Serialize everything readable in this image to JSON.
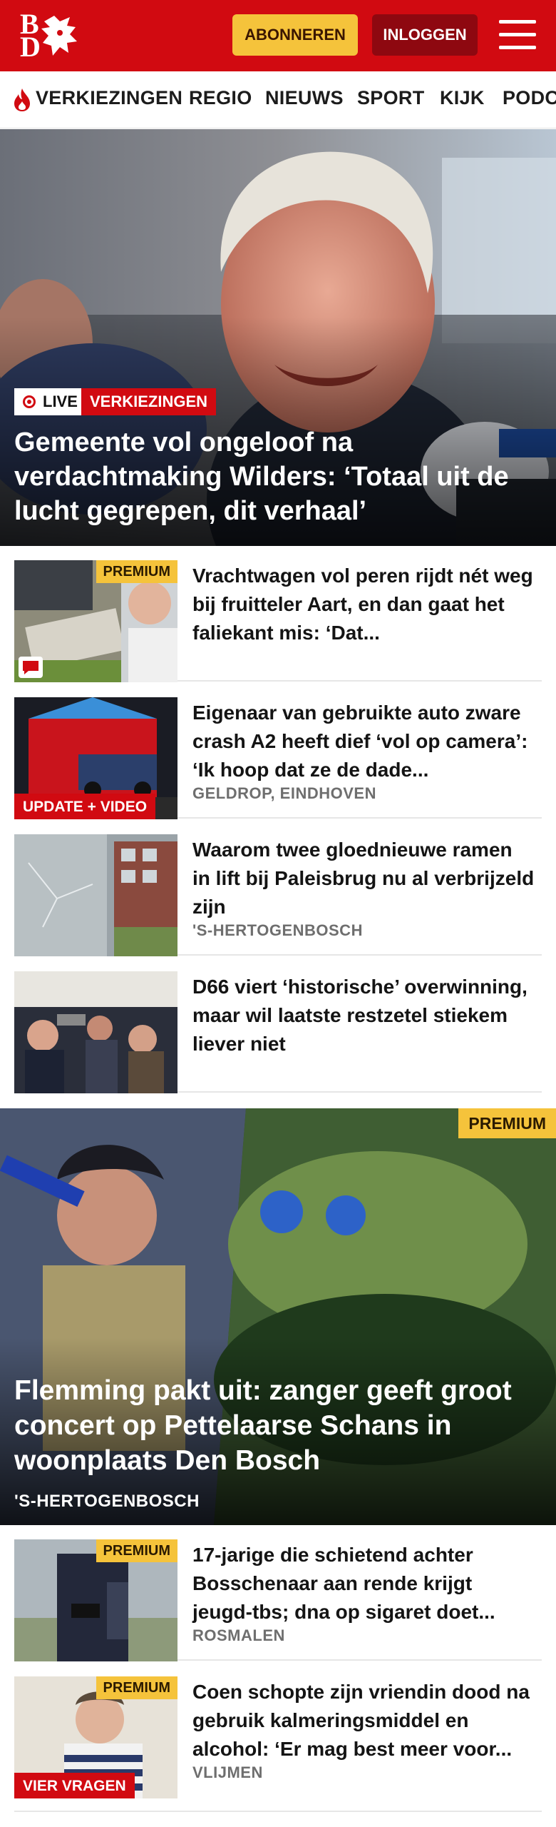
{
  "header": {
    "logo_text": "BD",
    "subscribe_label": "ABONNEREN",
    "login_label": "INLOGGEN",
    "menu_icon": "hamburger-menu-icon",
    "brand_color": "#d10a11",
    "accent_color": "#f5c33b"
  },
  "nav": {
    "items": [
      {
        "label": "VERKIEZINGEN",
        "icon": "flame-icon"
      },
      {
        "label": "REGIO"
      },
      {
        "label": "NIEUWS"
      },
      {
        "label": "SPORT"
      },
      {
        "label": "KIJK"
      },
      {
        "label": "PODC"
      }
    ]
  },
  "hero": {
    "live_label": "LIVE",
    "topic_label": "VERKIEZINGEN",
    "title": "Gemeente vol ongeloof na verdachtmaking Wilders: ‘Totaal uit de lucht gegrepen, dit verhaal’"
  },
  "articles": [
    {
      "title": "Vrachtwagen vol peren rijdt nét weg bij fruitteler Aart, en dan gaat het faliekant mis: ‘Dat...",
      "premium": "PREMIUM",
      "icon": "comment-icon"
    },
    {
      "title": "Eigenaar van gebruikte auto zware crash A2 heeft dief ‘vol op camera’: ‘Ik hoop dat ze de dade...",
      "location": "GELDROP, EINDHOVEN",
      "tag": "UPDATE + VIDEO"
    },
    {
      "title": "Waarom twee gloednieuwe ramen in lift bij Paleisbrug nu al verbrijzeld zijn",
      "location": "'S-HERTOGENBOSCH"
    },
    {
      "title": "D66 viert ‘historische’ overwin­ning, maar wil laatste restzetel stiekem liever niet"
    }
  ],
  "hero2": {
    "premium": "PREMIUM",
    "title": "Flemming pakt uit: zanger geeft groot concert op Pettelaarse Schans in woonplaats Den Bosch",
    "location": "'S-HERTOGENBOSCH"
  },
  "articles2": [
    {
      "title": "17-jarige die schietend achter Bosschenaar aan rende krijgt jeugd-tbs; dna op sigaret doet...",
      "location": "ROSMALEN",
      "premium": "PREMIUM"
    },
    {
      "title": "Coen schopte zijn vriendin dood na gebruik kalmeringsmiddel en alcohol: ‘Er mag best meer voor...",
      "location": "VLIJMEN",
      "premium": "PREMIUM",
      "tag": "VIER VRAGEN"
    }
  ]
}
